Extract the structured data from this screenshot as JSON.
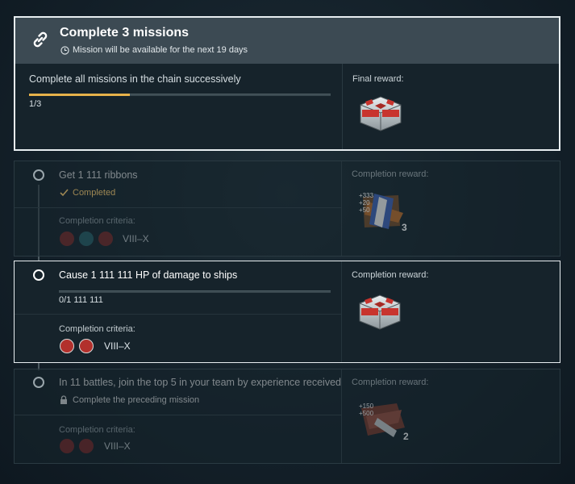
{
  "chain": {
    "title": "Complete 3 missions",
    "availability": "Mission will be available for the next 19 days",
    "description": "Complete all missions in the chain successively",
    "progress_text": "1/3",
    "progress_fraction": 0.333,
    "final_reward_label": "Final reward:"
  },
  "missions": [
    {
      "title": "Get 1 111 ribbons",
      "status": "Completed",
      "criteria_label": "Completion criteria:",
      "tier": "VIII–X",
      "reward_label": "Completion reward:",
      "reward_count": "3",
      "reward_overlay": [
        "+333",
        "+20",
        "+50"
      ]
    },
    {
      "title": "Cause 1 111 111 HP of damage to ships",
      "progress_text": "0/1 111 111",
      "progress_fraction": 0,
      "criteria_label": "Completion criteria:",
      "tier": "VIII–X",
      "reward_label": "Completion reward:"
    },
    {
      "title": "In 11 battles, join the top 5 in your team by experience received",
      "status": "Complete the preceding mission",
      "criteria_label": "Completion criteria:",
      "tier": "VIII–X",
      "reward_label": "Completion reward:",
      "reward_count": "2",
      "reward_overlay": [
        "+150",
        "+500"
      ]
    }
  ],
  "colors": {
    "accent_progress": "#e7b24a",
    "completed_text": "#d8b264",
    "card_border_active": "#e8eef1"
  },
  "icons": {
    "chain": "chain-link-icon",
    "clock": "clock-icon",
    "completed": "checkmark-icon",
    "locked": "lock-icon"
  }
}
